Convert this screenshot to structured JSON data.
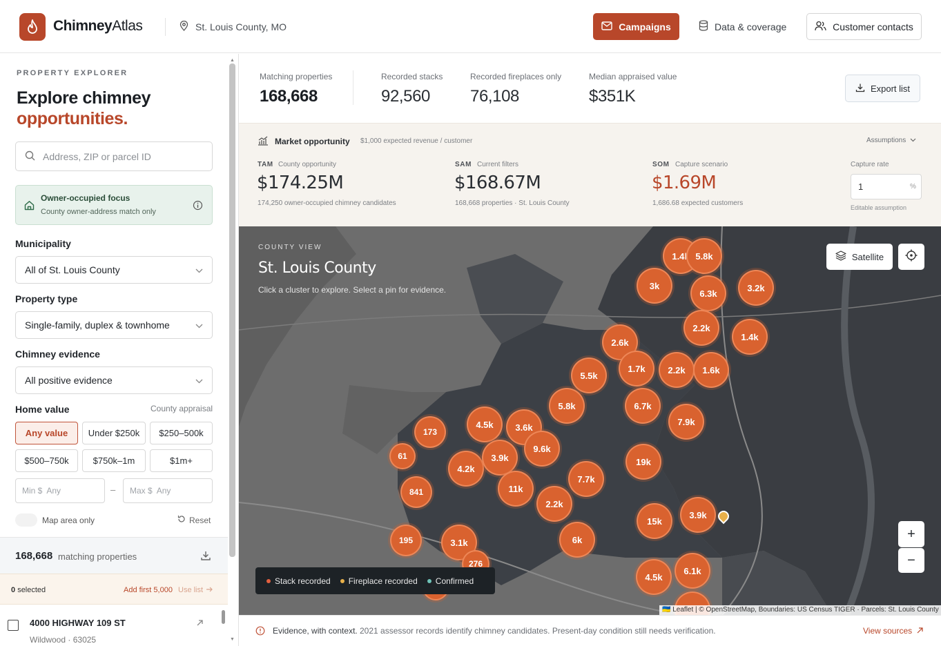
{
  "header": {
    "brand_strong": "Chimney",
    "brand_light": "Atlas",
    "location": "St. Louis County, MO",
    "campaigns_label": "Campaigns",
    "data_label": "Data & coverage",
    "contacts_label": "Customer contacts"
  },
  "sidebar": {
    "eyebrow": "PROPERTY EXPLORER",
    "heading_line1": "Explore chimney",
    "heading_line2": "opportunities.",
    "search_placeholder": "Address, ZIP or parcel ID",
    "owner_title": "Owner-occupied focus",
    "owner_sub": "County owner-address match only",
    "municipality_label": "Municipality",
    "municipality_value": "All of St. Louis County",
    "property_type_label": "Property type",
    "property_type_value": "Single-family, duplex & townhome",
    "evidence_label": "Chimney evidence",
    "evidence_value": "All positive evidence",
    "home_value_label": "Home value",
    "home_value_note": "County appraisal",
    "chips": [
      "Any value",
      "Under $250k",
      "$250–500k",
      "$500–750k",
      "$750k–1m",
      "$1m+"
    ],
    "active_chip": "Any value",
    "min_label": "Min $",
    "min_placeholder": "Any",
    "max_label": "Max $",
    "max_placeholder": "Any",
    "range_dash": "–",
    "map_area_label": "Map area only",
    "map_area_on": false,
    "reset_label": "Reset",
    "matching_count": "168,668",
    "matching_label": "matching properties",
    "selected_count": "0",
    "selected_label": "selected",
    "add_first_label": "Add first 5,000",
    "use_list_label": "Use list",
    "result": {
      "address": "4000 HIGHWAY 109 ST",
      "city": "Wildwood",
      "zip": "63025",
      "sep": "·"
    }
  },
  "stats": {
    "matching_label": "Matching properties",
    "matching_value": "168,668",
    "stacks_label": "Recorded stacks",
    "stacks_value": "92,560",
    "fireplaces_label": "Recorded fireplaces only",
    "fireplaces_value": "76,108",
    "median_label": "Median appraised value",
    "median_value": "$351K",
    "export_label": "Export list"
  },
  "market": {
    "title": "Market opportunity",
    "subtitle": "$1,000 expected revenue / customer",
    "assumptions_label": "Assumptions",
    "tam_tag": "TAM",
    "tam_sub": "County opportunity",
    "tam_value": "$174.25M",
    "tam_note": "174,250 owner-occupied chimney candidates",
    "sam_tag": "SAM",
    "sam_sub": "Current filters",
    "sam_value": "$168.67M",
    "sam_note": "168,668 properties · St. Louis County",
    "som_tag": "SOM",
    "som_sub": "Capture scenario",
    "som_value": "$1.69M",
    "som_note": "1,686.68 expected customers",
    "capture_label": "Capture rate",
    "capture_value": "1",
    "capture_unit": "%",
    "capture_note": "Editable assumption",
    "accent": "#b8472a"
  },
  "map": {
    "eyebrow": "COUNTY VIEW",
    "title": "St. Louis County",
    "hint": "Click a cluster to explore. Select a pin for evidence.",
    "satellite_label": "Satellite",
    "zoom_in": "+",
    "zoom_out": "−",
    "attribution": "🇺🇦 Leaflet | © OpenStreetMap, Boundaries: US Census TIGER · Parcels: St. Louis County",
    "legend": [
      {
        "label": "Stack recorded",
        "color": "#e4603f"
      },
      {
        "label": "Fireplace recorded",
        "color": "#e8b04a"
      },
      {
        "label": "Confirmed",
        "color": "#6fc3b8"
      }
    ],
    "clusters": [
      "1.4k",
      "5.8k",
      "3k",
      "6.3k",
      "3.2k",
      "2.2k",
      "1.4k",
      "2.6k",
      "1.7k",
      "2.2k",
      "1.6k",
      "5.5k",
      "5.8k",
      "6.7k",
      "7.9k",
      "173",
      "4.5k",
      "3.6k",
      "9.6k",
      "61",
      "4.2k",
      "3.9k",
      "7.7k",
      "19k",
      "841",
      "11k",
      "2.2k",
      "15k",
      "3.9k",
      "195",
      "3.1k",
      "6k",
      "276",
      "4.5k",
      "6.1k"
    ]
  },
  "footer": {
    "lead": "Evidence, with context.",
    "text": "2021 assessor records identify chimney candidates. Present-day condition still needs verification.",
    "link": "View sources"
  }
}
